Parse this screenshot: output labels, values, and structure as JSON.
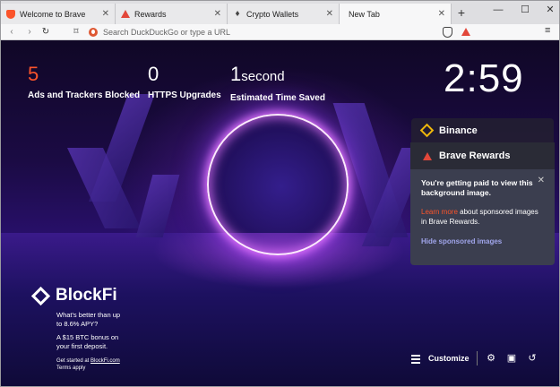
{
  "tabs": [
    {
      "title": "Welcome to Brave",
      "favicon": "brave-lion-icon"
    },
    {
      "title": "Rewards",
      "favicon": "bat-triangle-icon"
    },
    {
      "title": "Crypto Wallets",
      "favicon": "ethereum-icon"
    },
    {
      "title": "New Tab",
      "favicon": ""
    }
  ],
  "toolbar": {
    "url_placeholder": "Search DuckDuckGo or type a URL"
  },
  "stats": [
    {
      "value": "5",
      "unit": "",
      "label": "Ads and Trackers Blocked"
    },
    {
      "value": "0",
      "unit": "",
      "label": "HTTPS Upgrades"
    },
    {
      "value": "1",
      "unit": "second",
      "label": "Estimated Time Saved"
    }
  ],
  "clock": "2:59",
  "widgets": {
    "binance": {
      "title": "Binance"
    },
    "rewards": {
      "title": "Brave Rewards",
      "notice_title": "You're getting paid to view this background image.",
      "learn_more": "Learn more",
      "notice_text": " about sponsored images in Brave Rewards.",
      "hide_link": "Hide sponsored images"
    }
  },
  "sponsor": {
    "brand": "BlockFi",
    "line1": "What's better than up to 8.6% APY?",
    "line2": "A $15 BTC bonus on your first deposit.",
    "get_started": "Get started at ",
    "link": "BlockFi.com",
    "terms": "Terms apply"
  },
  "bottom": {
    "customize": "Customize"
  },
  "colors": {
    "brave_orange": "#fb542b",
    "binance_gold": "#f0b90b",
    "rewards_panel": "#3b3e4f",
    "hide_link": "#a0a5eb"
  }
}
